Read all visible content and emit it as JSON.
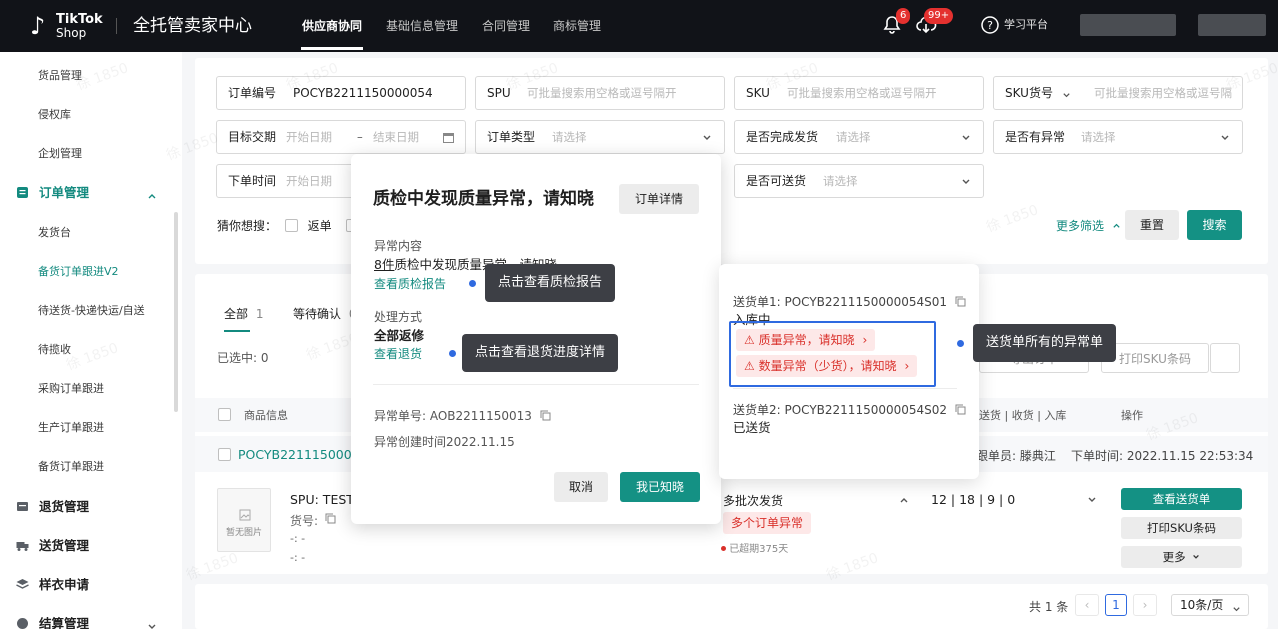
{
  "header": {
    "logo_line1": "TikTok",
    "logo_line2": "Shop",
    "app_title": "全托管卖家中心",
    "nav": [
      "供应商协同",
      "基础信息管理",
      "合同管理",
      "商标管理"
    ],
    "bell_badge": "6",
    "download_badge": "99+",
    "help_label": "学习平台"
  },
  "sidebar": {
    "items_top": [
      "货品管理",
      "侵权库",
      "企划管理"
    ],
    "order_group": "订单管理",
    "order_items": [
      "发货台",
      "备货订单跟进V2",
      "待送货-快递快运/自送",
      "待揽收",
      "采购订单跟进",
      "生产订单跟进",
      "备货订单跟进"
    ],
    "groups_bottom": [
      "退货管理",
      "送货管理",
      "样衣申请",
      "结算管理"
    ]
  },
  "filters": {
    "order_no_label": "订单编号",
    "order_no_value": "POCYB2211150000054",
    "spu_label": "SPU",
    "spu_placeholder": "可批量搜索用空格或逗号隔开",
    "sku_label": "SKU",
    "sku_placeholder": "可批量搜索用空格或逗号隔开",
    "sku_no_label": "SKU货号",
    "sku_no_placeholder": "可批量搜索用空格或逗号隔",
    "target_date_label": "目标交期",
    "start_date": "开始日期",
    "dash": "–",
    "end_date": "结束日期",
    "order_type_label": "订单类型",
    "select_placeholder": "请选择",
    "ship_done_label": "是否完成发货",
    "has_exception_label": "是否有异常",
    "order_time_label": "下单时间",
    "can_ship_label": "是否可送货",
    "guess_label": "猜你想搜：",
    "guess_option": "返单",
    "more_filter": "更多筛选",
    "reset": "重置",
    "search": "搜索"
  },
  "tabs": {
    "all": "全部",
    "all_count": "1",
    "waiting": "等待确认",
    "waiting_count": "0",
    "selected": "已选中: 0",
    "export": "导出订单",
    "print_sku": "打印SKU条码"
  },
  "table": {
    "col_product": "商品信息",
    "col_ship": "送货 | 收货 | 入库",
    "col_action": "操作",
    "order_no": "POCYB2211150000054",
    "follower": "跟单员: 滕典江",
    "order_time": "下单时间: 2022.11.15 22:53:34",
    "no_image": "暂无图片",
    "spu": "SPU: TEST",
    "item_no": "货号:",
    "dash1": "-: -",
    "dash2": "-: -",
    "multi_batch": "多批次发货",
    "multi_exception": "多个订单异常",
    "overdue": "已超期375天",
    "qty": "12 | 18 | 9 | 0",
    "view_delivery": "查看送货单",
    "print_sku": "打印SKU条码",
    "more": "更多"
  },
  "pagination": {
    "total": "共 1 条",
    "page": "1",
    "page_size": "10条/页"
  },
  "modal": {
    "title": "质检中发现质量异常，请知晓",
    "detail_btn": "订单详情",
    "content_label": "异常内容",
    "content_count": "8件",
    "content_text": "质检中发现质量异常，请知晓",
    "view_report": "查看质检报告",
    "handle_label": "处理方式",
    "handle_value": "全部返修",
    "view_return": "查看退货",
    "exception_no": "异常单号: AOB2211150013",
    "created_time": "异常创建时间2022.11.15",
    "cancel": "取消",
    "confirm": "我已知晓"
  },
  "popover": {
    "delivery1": "送货单1: POCYB2211150000054S01",
    "status1": "入库中",
    "quality_tag": "质量异常，请知晓",
    "quantity_tag": "数量异常（少货），请知晓",
    "delivery2": "送货单2: POCYB2211150000054S02",
    "status2": "已送货"
  },
  "tooltips": {
    "report": "点击查看质检报告",
    "return": "点击查看退货进度详情",
    "all_exceptions": "送货单所有的异常单"
  },
  "watermark": "徐 1850",
  "colors": {
    "accent": "#149184",
    "danger": "#d9302a",
    "highlight": "#2f6ae0"
  }
}
